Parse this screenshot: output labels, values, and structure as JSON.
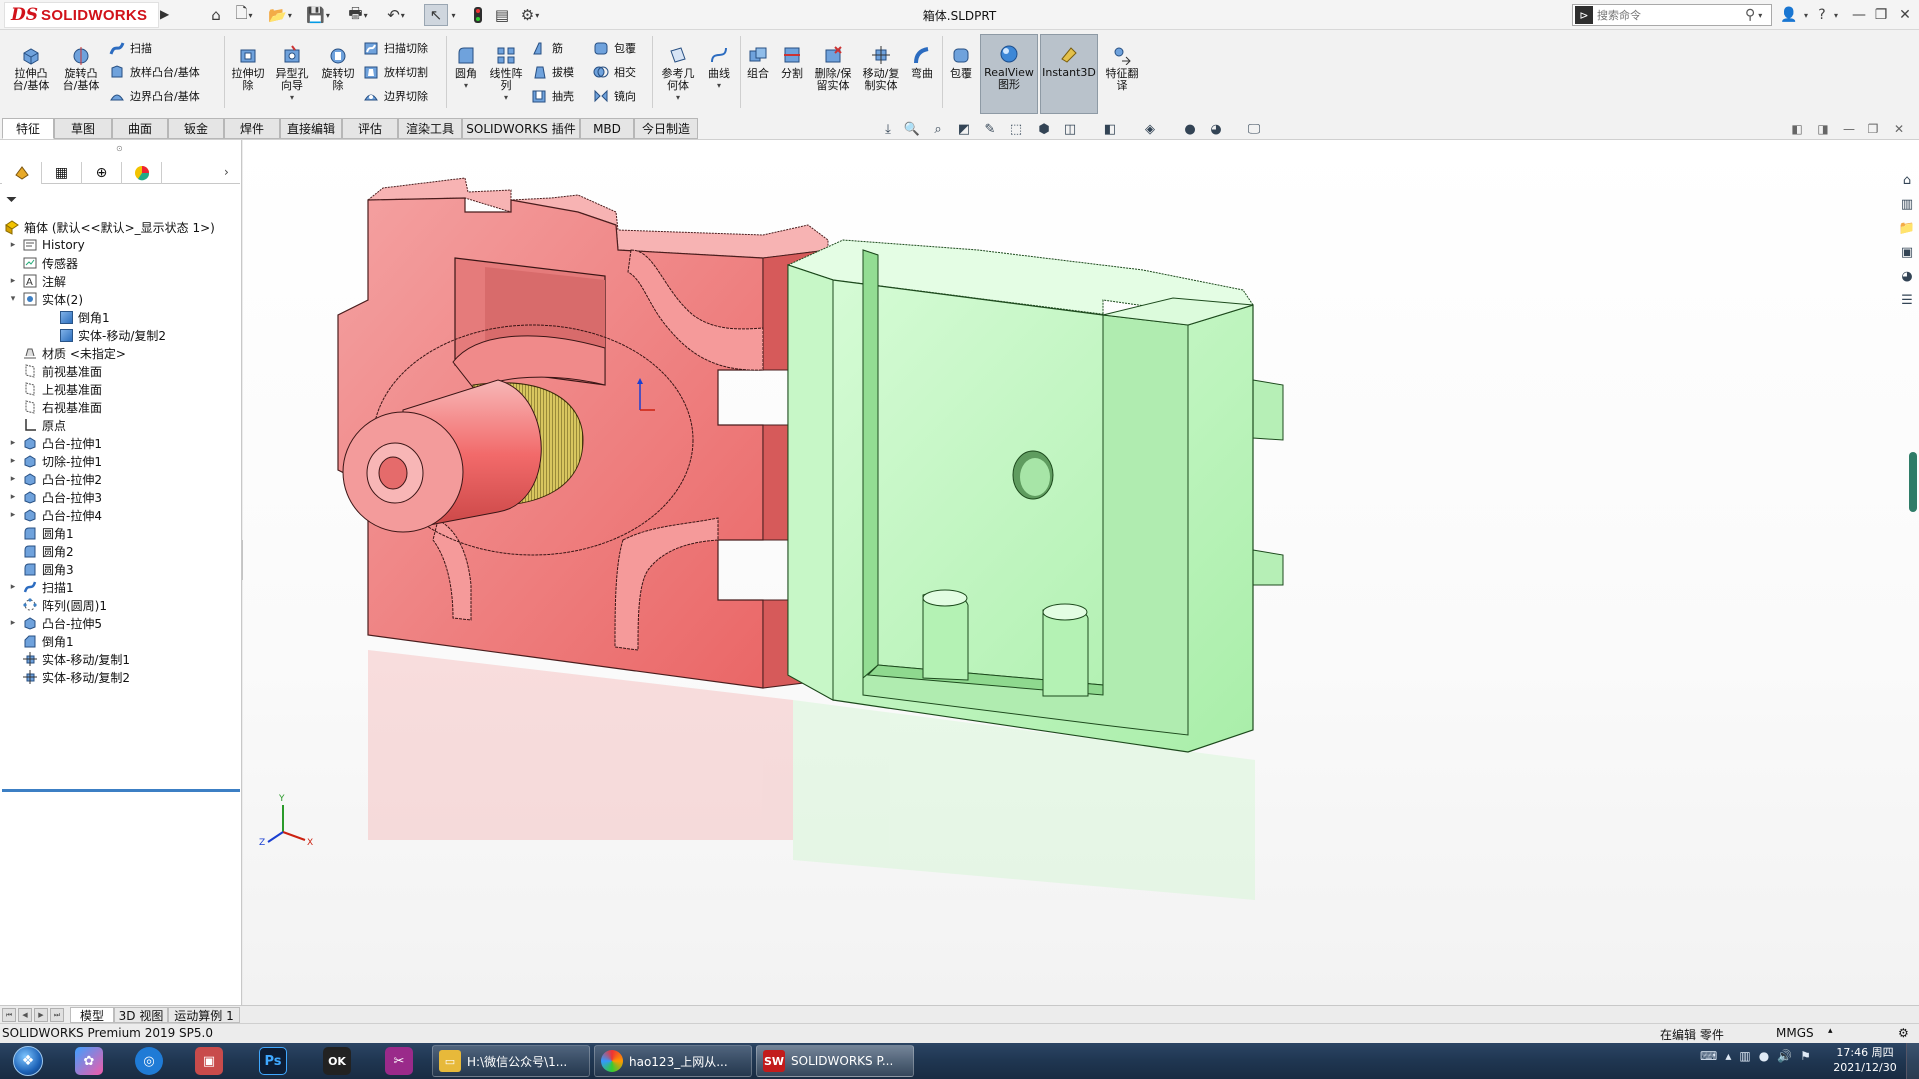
{
  "app": {
    "logo_ds": "DS",
    "logo_name": "SOLIDWORKS",
    "doc_title": "箱体.SLDPRT",
    "search_placeholder": "搜索命令"
  },
  "commands": {
    "extrude_boss": "拉伸凸\n台/基体",
    "revolve_boss": "旋转凸\n台/基体",
    "sweep": "扫描",
    "loft_boss": "放样凸台/基体",
    "boundary_boss": "边界凸台/基体",
    "extrude_cut": "拉伸切\n除",
    "hole_wizard": "异型孔\n向导",
    "revolve_cut": "旋转切\n除",
    "swept_cut": "扫描切除",
    "lofted_cut": "放样切割",
    "boundary_cut": "边界切除",
    "fillet": "圆角",
    "linear_pattern": "线性阵\n列",
    "rib": "筋",
    "draft": "拔模",
    "shell": "抽壳",
    "wrap": "包覆",
    "intersect": "相交",
    "mirror": "镜向",
    "ref_geometry": "参考几\n何体",
    "curves": "曲线",
    "combine": "组合",
    "split": "分割",
    "delete_keep_body": "删除/保\n留实体",
    "move_copy_body": "移动/复\n制实体",
    "flex": "弯曲",
    "wrap2": "包覆",
    "realview": "RealView\n图形",
    "instant3d": "Instant3D",
    "feature_translate": "特征翻\n译"
  },
  "tabs": [
    "特征",
    "草图",
    "曲面",
    "钣金",
    "焊件",
    "直接编辑",
    "评估",
    "渲染工具",
    "SOLIDWORKS 插件",
    "MBD",
    "今日制造"
  ],
  "tree": {
    "root": "箱体 (默认<<默认>_显示状态 1>)",
    "items": [
      {
        "label": "History",
        "expand": "▸",
        "icon": "history"
      },
      {
        "label": "传感器",
        "expand": "",
        "icon": "sensor"
      },
      {
        "label": "注解",
        "expand": "▸",
        "icon": "annotation"
      },
      {
        "label": "实体(2)",
        "expand": "▾",
        "icon": "solid-bodies"
      },
      {
        "label": "倒角1",
        "expand": "",
        "icon": "body",
        "indent": 1
      },
      {
        "label": "实体-移动/复制2",
        "expand": "",
        "icon": "body",
        "indent": 1
      },
      {
        "label": "材质 <未指定>",
        "expand": "",
        "icon": "material"
      },
      {
        "label": "前视基准面",
        "expand": "",
        "icon": "plane"
      },
      {
        "label": "上视基准面",
        "expand": "",
        "icon": "plane"
      },
      {
        "label": "右视基准面",
        "expand": "",
        "icon": "plane"
      },
      {
        "label": "原点",
        "expand": "",
        "icon": "origin"
      },
      {
        "label": "凸台-拉伸1",
        "expand": "▸",
        "icon": "extrude"
      },
      {
        "label": "切除-拉伸1",
        "expand": "▸",
        "icon": "extrude"
      },
      {
        "label": "凸台-拉伸2",
        "expand": "▸",
        "icon": "extrude"
      },
      {
        "label": "凸台-拉伸3",
        "expand": "▸",
        "icon": "extrude"
      },
      {
        "label": "凸台-拉伸4",
        "expand": "▸",
        "icon": "extrude"
      },
      {
        "label": "圆角1",
        "expand": "",
        "icon": "fillet"
      },
      {
        "label": "圆角2",
        "expand": "",
        "icon": "fillet"
      },
      {
        "label": "圆角3",
        "expand": "",
        "icon": "fillet"
      },
      {
        "label": "扫描1",
        "expand": "▸",
        "icon": "sweep"
      },
      {
        "label": "阵列(圆周)1",
        "expand": "",
        "icon": "pattern"
      },
      {
        "label": "凸台-拉伸5",
        "expand": "▸",
        "icon": "extrude"
      },
      {
        "label": "倒角1",
        "expand": "",
        "icon": "chamfer"
      },
      {
        "label": "实体-移动/复制1",
        "expand": "",
        "icon": "move-copy"
      },
      {
        "label": "实体-移动/复制2",
        "expand": "",
        "icon": "move-copy"
      }
    ]
  },
  "bottom_tabs": [
    "模型",
    "3D 视图",
    "运动算例 1"
  ],
  "status": {
    "product": "SOLIDWORKS Premium 2019 SP5.0",
    "editing": "在编辑 零件",
    "units": "MMGS"
  },
  "taskbar": {
    "tasks": [
      {
        "label": "H:\\微信公众号\\1...",
        "icon": "folder-icon"
      },
      {
        "label": "hao123_上网从...",
        "icon": "browser-icon"
      },
      {
        "label": "SOLIDWORKS P...",
        "icon": "solidworks-icon"
      }
    ],
    "time": "17:46 周四",
    "date": "2021/12/30"
  },
  "axes": {
    "x": "X",
    "y": "Y",
    "z": "Z"
  },
  "colors": {
    "red_body": "#f07c7c",
    "green_body": "#b8f5b8",
    "accent": "#d1121a",
    "taskbar": "#1f3651"
  }
}
